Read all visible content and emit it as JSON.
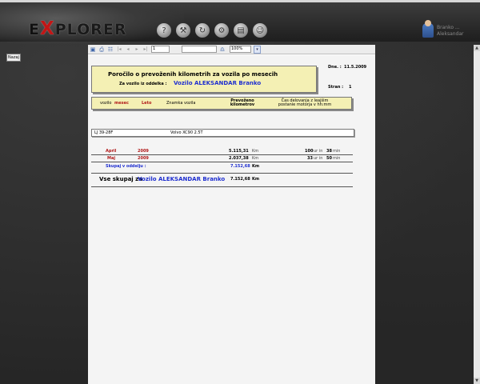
{
  "app": {
    "logo_x": "X",
    "logo_e": "E",
    "logo_rest": "PLORER",
    "user_name": "Branko ... Aleksandar"
  },
  "nav": {
    "back_label": "Nazaj"
  },
  "toolbar": {
    "page_value": "1",
    "zoom_value": "100%",
    "search_value": ""
  },
  "report": {
    "title": "Poročilo o prevoženih kilometrih za vozila po mesecih",
    "subtitle_label": "Za vozilo iz oddelka :",
    "subtitle_value": "Vozilo ALEKSANDAR Branko",
    "date_label": "Dne. :",
    "date_value": "11.5.2009",
    "page_label": "Stran :",
    "page_value": "1",
    "columns": {
      "vehicle": "vozilo",
      "month": "mesec",
      "year": "Leto",
      "brand": "Znamka vozila",
      "km": "Prevoženo kilometrov",
      "time": "Čas delovanja z leajšim postanie motorja v hh:mm"
    },
    "vehicle": {
      "plate": "LJ 39-28F",
      "model": "Volvo XC90 2.5T"
    },
    "rows": [
      {
        "month": "April",
        "year": "2009",
        "km": "5.115,31",
        "unit": "Km",
        "hours": "100",
        "ur": "ur in",
        "minutes": "38",
        "min": "min"
      },
      {
        "month": "Maj",
        "year": "2009",
        "km": "2.037,38",
        "unit": "Km",
        "hours": "33",
        "ur": "ur in",
        "minutes": "50",
        "min": "min"
      }
    ],
    "subtotal": {
      "label": "Skupaj v oddelju :",
      "km": "7.152,68",
      "unit": "Km"
    },
    "total": {
      "label": "Vse skupaj za",
      "name": "Vozilo ALEKSANDAR Branko",
      "km": "7.152,68",
      "unit": "Km"
    }
  }
}
